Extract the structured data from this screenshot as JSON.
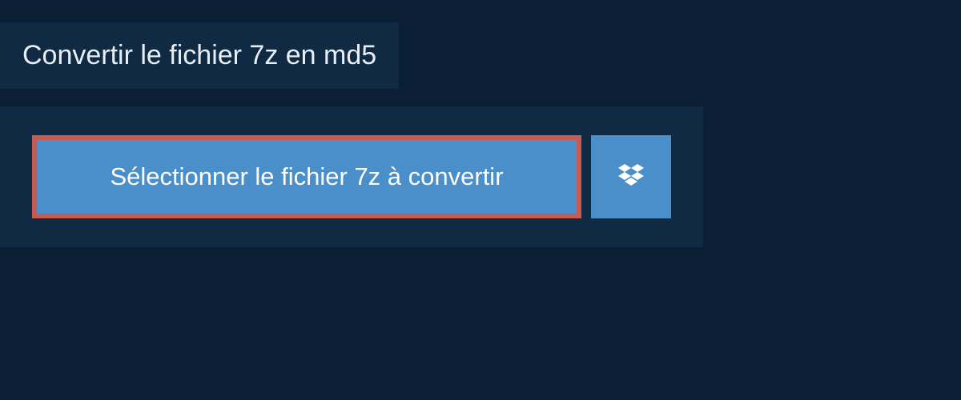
{
  "header": {
    "title": "Convertir le fichier 7z en md5"
  },
  "upload": {
    "select_button_label": "Sélectionner le fichier 7z à convertir"
  },
  "colors": {
    "background": "#0a1f33",
    "panel": "#0f2a42",
    "button": "#4a8fc9",
    "highlight_border": "#c85a54",
    "text_light": "#e8eef5"
  }
}
